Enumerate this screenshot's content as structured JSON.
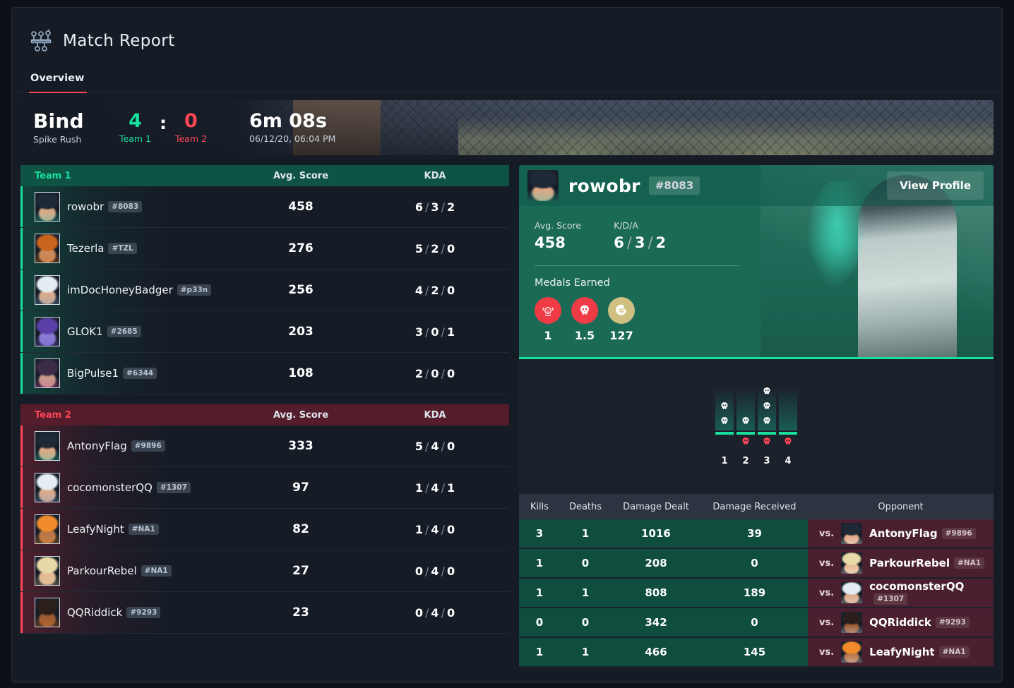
{
  "header": {
    "title": "Match Report",
    "icon": "bracket-icon"
  },
  "tabs": [
    {
      "label": "Overview",
      "active": true
    }
  ],
  "match": {
    "map": "Bind",
    "mode": "Spike Rush",
    "team1_score": "4",
    "team2_score": "0",
    "colon": ":",
    "team1_label": "Team 1",
    "team2_label": "Team 2",
    "duration": "6m 08s",
    "datetime": "06/12/20, 06:04 PM"
  },
  "colors": {
    "team1": "#18e09c",
    "team2": "#ff4655",
    "accent_tab": "#ff4655",
    "medal_red": "#ee3b46",
    "medal_gold": "#cfbf80",
    "panel_bg": "#1b222c",
    "page_bg": "#0d1117"
  },
  "team1": {
    "header": {
      "name": "Team 1",
      "score": "Avg. Score",
      "kda": "KDA"
    },
    "players": [
      {
        "name": "rowobr",
        "tag": "#8083",
        "score": "458",
        "k": "6",
        "d": "3",
        "a": "2",
        "hair": "#1e2836",
        "skin": "#e0a886",
        "accent": "#2fd6b6"
      },
      {
        "name": "Tezerla",
        "tag": "#TZL",
        "score": "276",
        "k": "5",
        "d": "2",
        "a": "0",
        "hair": "#c8641e",
        "skin": "#c98a5e",
        "accent": "#e0761f"
      },
      {
        "name": "imDocHoneyBadger",
        "tag": "#p33n",
        "score": "256",
        "k": "4",
        "d": "2",
        "a": "0",
        "hair": "#e4edf4",
        "skin": "#dba98a",
        "accent": "#7fa8d8"
      },
      {
        "name": "GLOK1",
        "tag": "#2685",
        "score": "203",
        "k": "3",
        "d": "0",
        "a": "1",
        "hair": "#5b3fa8",
        "skin": "#8a7bd0",
        "accent": "#7b5ce0"
      },
      {
        "name": "BigPulse1",
        "tag": "#6344",
        "score": "108",
        "k": "2",
        "d": "0",
        "a": "0",
        "hair": "#3b2b46",
        "skin": "#c89a88",
        "accent": "#d05bb0"
      }
    ]
  },
  "team2": {
    "header": {
      "name": "Team 2",
      "score": "Avg. Score",
      "kda": "KDA"
    },
    "players": [
      {
        "name": "AntonyFlag",
        "tag": "#9896",
        "score": "333",
        "k": "5",
        "d": "4",
        "a": "0",
        "hair": "#1e2836",
        "skin": "#e0a886",
        "accent": "#2fd6b6"
      },
      {
        "name": "cocomonsterQQ",
        "tag": "#1307",
        "score": "97",
        "k": "1",
        "d": "4",
        "a": "1",
        "hair": "#e4edf4",
        "skin": "#dba98a",
        "accent": "#7fa8d8"
      },
      {
        "name": "LeafyNight",
        "tag": "#NA1",
        "score": "82",
        "k": "1",
        "d": "4",
        "a": "0",
        "hair": "#f08a2a",
        "skin": "#b5744a",
        "accent": "#f0922a"
      },
      {
        "name": "ParkourRebel",
        "tag": "#NA1",
        "score": "27",
        "k": "0",
        "d": "4",
        "a": "0",
        "hair": "#e8d9a8",
        "skin": "#e5bb96",
        "accent": "#cfc08a"
      },
      {
        "name": "QQRiddick",
        "tag": "#9293",
        "score": "23",
        "k": "0",
        "d": "4",
        "a": "0",
        "hair": "#2a1f1a",
        "skin": "#9a5a34",
        "accent": "#e07a2a"
      }
    ]
  },
  "player_panel": {
    "name": "rowobr",
    "tag": "#8083",
    "view_profile": "View Profile",
    "avg_score_label": "Avg. Score",
    "avg_score_value": "458",
    "kda_label": "K/D/A",
    "kda_k": "6",
    "kda_d": "3",
    "kda_a": "2",
    "medals_title": "Medals Earned",
    "medals": [
      {
        "icon": "clutch-medal-icon",
        "style": "red",
        "value": "1"
      },
      {
        "icon": "skull-medal-icon",
        "style": "red",
        "value": "1.5"
      },
      {
        "icon": "moon-medal-icon",
        "style": "gold",
        "value": "127"
      }
    ]
  },
  "rounds": [
    {
      "num": "1",
      "kills": 2,
      "deaths": 0,
      "won": true
    },
    {
      "num": "2",
      "kills": 1,
      "deaths": 1,
      "won": true
    },
    {
      "num": "3",
      "kills": 3,
      "deaths": 1,
      "won": true
    },
    {
      "num": "4",
      "kills": 0,
      "deaths": 1,
      "won": true
    }
  ],
  "opponent_table": {
    "columns": {
      "kills": "Kills",
      "deaths": "Deaths",
      "damage_dealt": "Damage Dealt",
      "damage_received": "Damage Received",
      "opponent": "Opponent"
    },
    "vs_label": "vs.",
    "rows": [
      {
        "kills": "3",
        "deaths": "1",
        "damage_dealt": "1016",
        "damage_received": "39",
        "opponent": "AntonyFlag",
        "tag": "#9896",
        "hair": "#1e2836",
        "skin": "#e0a886"
      },
      {
        "kills": "1",
        "deaths": "0",
        "damage_dealt": "208",
        "damage_received": "0",
        "opponent": "ParkourRebel",
        "tag": "#NA1",
        "hair": "#e8d9a8",
        "skin": "#e5bb96"
      },
      {
        "kills": "1",
        "deaths": "1",
        "damage_dealt": "808",
        "damage_received": "189",
        "opponent": "cocomonsterQQ",
        "tag": "#1307",
        "hair": "#e4edf4",
        "skin": "#dba98a"
      },
      {
        "kills": "0",
        "deaths": "0",
        "damage_dealt": "342",
        "damage_received": "0",
        "opponent": "QQRiddick",
        "tag": "#9293",
        "hair": "#2a1f1a",
        "skin": "#9a5a34"
      },
      {
        "kills": "1",
        "deaths": "1",
        "damage_dealt": "466",
        "damage_received": "145",
        "opponent": "LeafyNight",
        "tag": "#NA1",
        "hair": "#f08a2a",
        "skin": "#b5744a"
      }
    ]
  }
}
